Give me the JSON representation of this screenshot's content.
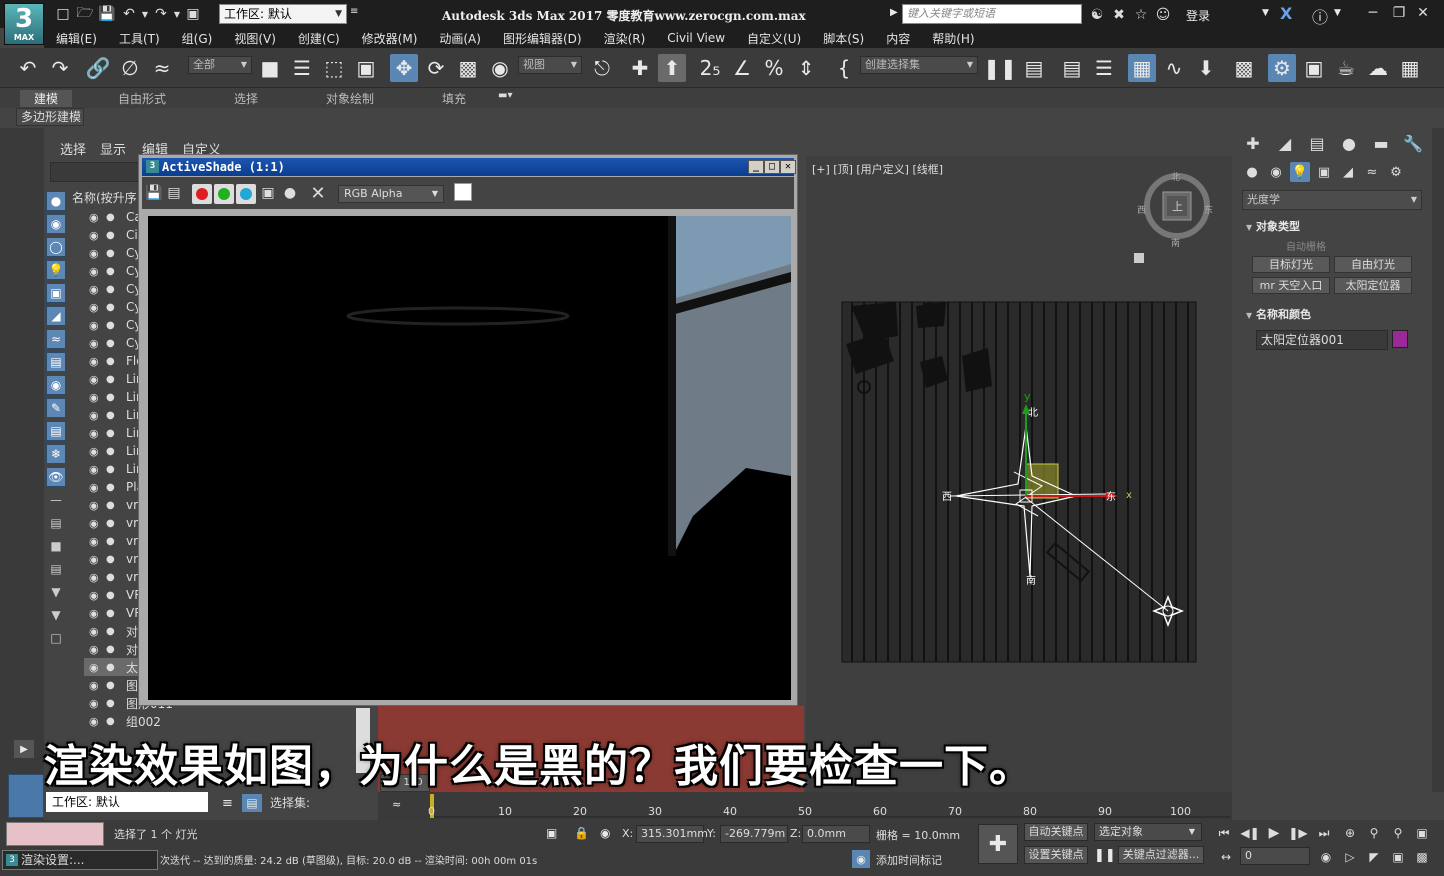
{
  "app": {
    "logo_text": "3",
    "logo_sub": "MAX",
    "title": "Autodesk 3ds Max 2017    零度教育www.zerocgn.com.max",
    "workspace_label": "工作区: 默认",
    "search_placeholder": "键入关键字或短语",
    "login": "登录"
  },
  "menu": [
    "编辑(E)",
    "工具(T)",
    "组(G)",
    "视图(V)",
    "创建(C)",
    "修改器(M)",
    "动画(A)",
    "图形编辑器(D)",
    "渲染(R)",
    "Civil View",
    "自定义(U)",
    "脚本(S)",
    "内容",
    "帮助(H)"
  ],
  "toolbar": {
    "filter_value": "全部",
    "refcoord_value": "视图",
    "selset_value": "创建选择集"
  },
  "ribbon": {
    "tabs": [
      "建模",
      "自由形式",
      "选择",
      "对象绘制",
      "填充"
    ],
    "active_tab": "建模",
    "sub_tab": "多边形建模"
  },
  "explorer": {
    "tabs": [
      "选择",
      "显示",
      "编辑",
      "自定义"
    ],
    "column_header": "名称(按升序",
    "items": [
      "Ca",
      "Cir",
      "Cy",
      "Cy",
      "Cy",
      "Cy",
      "Cy",
      "Cy",
      "Flo",
      "Lin",
      "Lin",
      "Lin",
      "Lin",
      "Lin",
      "Lin",
      "Pla",
      "vr",
      "vr",
      "vr",
      "vr",
      "vr",
      "VR",
      "VR",
      "对",
      "对",
      "太",
      "图",
      "图形011",
      "组002"
    ],
    "workspace": "工作区: 默认",
    "selection_set_label": "选择集:"
  },
  "activeshade": {
    "title": "ActiveShade  (1:1)",
    "channel": "RGB Alpha"
  },
  "viewport": {
    "label": "[+] [顶] [用户定义] [线框]",
    "compass": {
      "north": "北",
      "south": "南",
      "east": "东",
      "west": "西"
    },
    "cube_face": "上",
    "axis_x": "x",
    "axis_y": "y"
  },
  "command_panel": {
    "category": "光度学",
    "section_object_type": "对象类型",
    "auto_grid": "自动栅格",
    "buttons": [
      "目标灯光",
      "自由灯光",
      "mr 天空入口",
      "太阳定位器"
    ],
    "section_name_color": "名称和颜色",
    "object_name": "太阳定位器001",
    "object_color": "#9a2a9a"
  },
  "timeline": {
    "frame_display": "0 / 100",
    "ticks": [
      "0",
      "10",
      "20",
      "30",
      "40",
      "50",
      "60",
      "70",
      "80",
      "90",
      "100"
    ]
  },
  "status": {
    "selected": "选择了 1 个 灯光",
    "message": "次迭代 -- 达到的质量: 24.2 dB (草图级), 目标: 20.0 dB -- 渲染时间: 00h 00m 01s",
    "task": "渲染设置:...",
    "x_label": "X:",
    "x_value": "315.301mm",
    "y_label": "Y:",
    "y_value": "-269.779m",
    "z_label": "Z:",
    "z_value": "0.0mm",
    "grid": "栅格 = 10.0mm",
    "add_time_tag": "添加时间标记",
    "auto_key": "自动关键点",
    "set_key": "设置关键点",
    "selected_obj": "选定对象",
    "key_filters": "关键点过滤器...",
    "frame": "0"
  },
  "subtitle": "渲染效果如图，为什么是黑的？我们要检查一下。"
}
